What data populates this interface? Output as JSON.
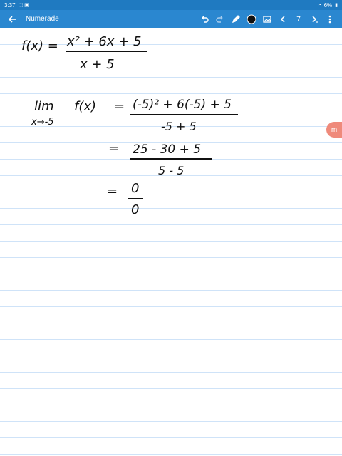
{
  "status": {
    "time": "3:37",
    "battery": "6%"
  },
  "toolbar": {
    "title": "Numerade",
    "page_number": "7",
    "icons": [
      "back-arrow-icon",
      "undo-icon",
      "redo-icon",
      "pen-icon",
      "color-dot-icon",
      "image-icon",
      "prev-page-icon",
      "next-page-icon",
      "menu-dots-icon"
    ],
    "accent": "#2a87d0"
  },
  "notes": {
    "line1": {
      "lhs": "f(x) =",
      "numerator": "x² + 6x + 5",
      "denominator": "x + 5"
    },
    "line2": {
      "lim": "lim",
      "sub": "x→-5",
      "fx": "f(x)",
      "eq": "=",
      "numerator": "(-5)² + 6(-5) + 5",
      "denominator": "-5 + 5"
    },
    "line3": {
      "eq": "=",
      "numerator": "25 - 30 + 5",
      "denominator": "5 - 5"
    },
    "line4": {
      "eq": "=",
      "numerator": "0",
      "denominator": "0"
    }
  },
  "badge": {
    "label": "m"
  }
}
